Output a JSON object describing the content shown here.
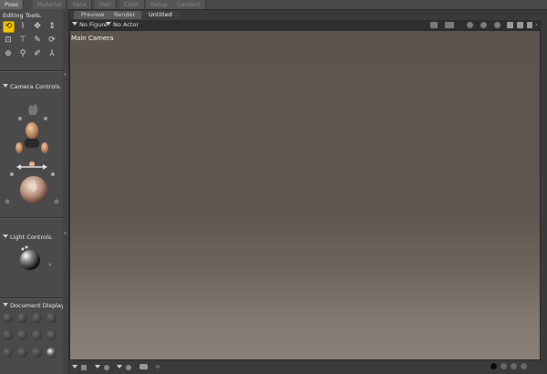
{
  "top_tabs": [
    "Pose",
    "Material",
    "Face",
    "Hair",
    "Cloth",
    "Setup",
    "Content"
  ],
  "left": {
    "editing_tools_title": "Editing Tools.",
    "camera_controls_title": "Camera Controls.",
    "light_controls_title": "Light Controls.",
    "document_display_title": "Document Display S"
  },
  "doc_tabs": [
    "Preview",
    "Render",
    "Untitled"
  ],
  "toolbar": {
    "figure_dropdown": "No Figure",
    "actor_dropdown": "No Actor"
  },
  "viewport": {
    "camera_label": "Main Camera"
  },
  "icons": {
    "editing_tools": [
      "rotate-icon",
      "twist-icon",
      "translate-icon",
      "scale-icon",
      "taper-icon",
      "chain-break-icon",
      "color-icon",
      "grouping-icon",
      "view-magnifier-icon",
      "morph-brush-icon",
      "direct-manipulation-icon",
      "selection-icon"
    ]
  },
  "colors": {
    "selected_tool": "#f2c200",
    "viewport_top": "#5c554d",
    "viewport_floor": "#8a8078"
  }
}
